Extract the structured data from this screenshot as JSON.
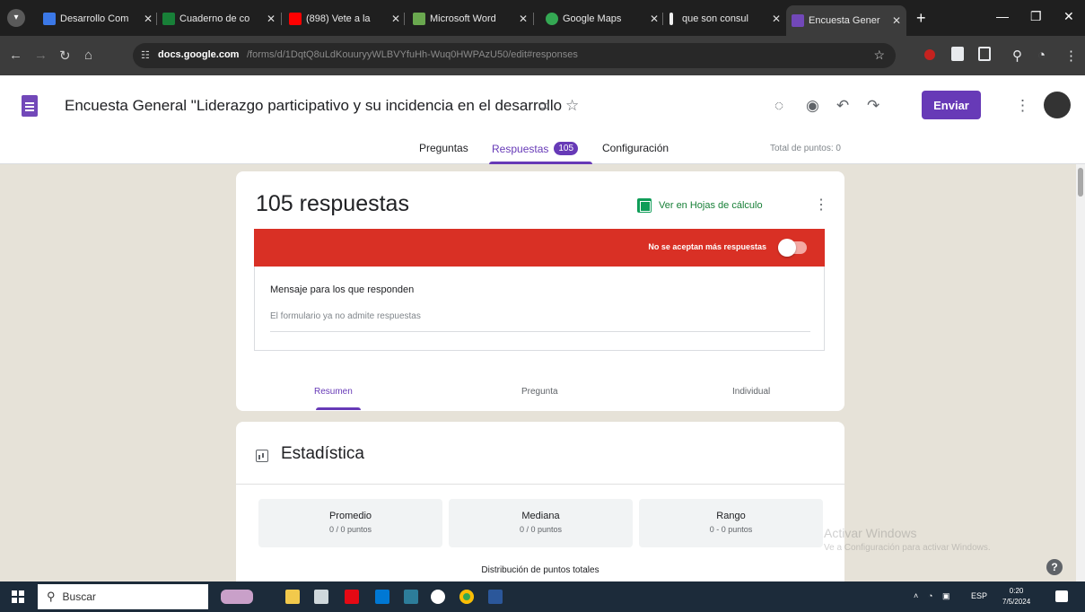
{
  "browser": {
    "tabs": [
      {
        "title": "Desarrollo Com",
        "fav_color": "#3b78e7"
      },
      {
        "title": "Cuaderno de co",
        "fav_color": "#188038"
      },
      {
        "title": "(898) Vete a la",
        "fav_color": "#ff0000"
      },
      {
        "title": "Microsoft Word",
        "fav_color": "#6aa84f"
      },
      {
        "title": "Google Maps",
        "fav_color": "#34a853"
      },
      {
        "title": "que son consul",
        "fav_color": "#eeeeee"
      },
      {
        "title": "Encuesta Gener",
        "fav_color": "#7248b9"
      }
    ],
    "active_tab": 6,
    "url_host": "docs.google.com",
    "url_path": "/forms/d/1DqtQ8uLdKouuryyWLBVYfuHh-Wuq0HWPAzU50/edit#responses"
  },
  "form": {
    "title": "Encuesta General \"Liderazgo participativo y su incidencia en el desarrollo",
    "send_label": "Enviar",
    "tabs": {
      "questions": "Preguntas",
      "responses": "Respuestas",
      "responses_count": "105",
      "settings": "Configuración"
    },
    "total_points": "Total de puntos: 0"
  },
  "responses": {
    "count_label": "105 respuestas",
    "sheets_link": "Ver en Hojas de cálculo",
    "closed_label": "No se aceptan más respuestas",
    "accepting_responses": false,
    "message_title": "Mensaje para los que responden",
    "message_text": "El formulario ya no admite respuestas",
    "view_tabs": [
      "Resumen",
      "Pregunta",
      "Individual"
    ],
    "active_view": "Resumen"
  },
  "stats": {
    "title": "Estadística",
    "items": [
      {
        "label": "Promedio",
        "value": "0 / 0 puntos"
      },
      {
        "label": "Mediana",
        "value": "0 / 0 puntos"
      },
      {
        "label": "Rango",
        "value": "0 - 0 puntos"
      }
    ],
    "distribution_title": "Distribución de puntos totales"
  },
  "watermark": {
    "line1": "Activar Windows",
    "line2": "Ve a Configuración para activar Windows."
  },
  "taskbar": {
    "search_placeholder": "Buscar",
    "lang": "ESP",
    "time": "0:20",
    "date": "7/5/2024"
  },
  "colors": {
    "accent": "#673ab7",
    "closed_banner": "#d93025",
    "sheets_green": "#0f9d58"
  }
}
